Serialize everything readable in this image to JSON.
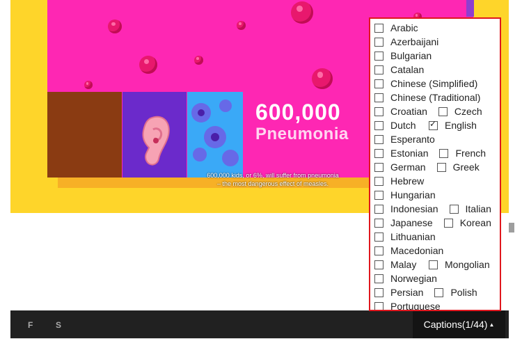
{
  "video": {
    "headline_number": "600,000",
    "headline_word": "Pneumonia",
    "subtitle_line1": "600,000 kids, or 6%, will suffer from pneumonia",
    "subtitle_line2": "– the most dangerous effect of measles."
  },
  "controls": {
    "left_buttons": [
      "F",
      "S"
    ],
    "captions_label": "Captions(1/44)",
    "captions_arrow": "▲"
  },
  "captions_menu": {
    "rows": [
      [
        {
          "label": "Arabic",
          "checked": false
        }
      ],
      [
        {
          "label": "Azerbaijani",
          "checked": false
        }
      ],
      [
        {
          "label": "Bulgarian",
          "checked": false
        }
      ],
      [
        {
          "label": "Catalan",
          "checked": false
        }
      ],
      [
        {
          "label": "Chinese (Simplified)",
          "checked": false
        }
      ],
      [
        {
          "label": "Chinese (Traditional)",
          "checked": false
        }
      ],
      [
        {
          "label": "Croatian",
          "checked": false
        },
        {
          "label": "Czech",
          "checked": false
        }
      ],
      [
        {
          "label": "Dutch",
          "checked": false
        },
        {
          "label": "English",
          "checked": true
        }
      ],
      [
        {
          "label": "Esperanto",
          "checked": false
        }
      ],
      [
        {
          "label": "Estonian",
          "checked": false
        },
        {
          "label": "French",
          "checked": false
        }
      ],
      [
        {
          "label": "German",
          "checked": false
        },
        {
          "label": "Greek",
          "checked": false
        }
      ],
      [
        {
          "label": "Hebrew",
          "checked": false
        }
      ],
      [
        {
          "label": "Hungarian",
          "checked": false
        }
      ],
      [
        {
          "label": "Indonesian",
          "checked": false
        },
        {
          "label": "Italian",
          "checked": false
        }
      ],
      [
        {
          "label": "Japanese",
          "checked": false
        },
        {
          "label": "Korean",
          "checked": false
        }
      ],
      [
        {
          "label": "Lithuanian",
          "checked": false
        }
      ],
      [
        {
          "label": "Macedonian",
          "checked": false
        }
      ],
      [
        {
          "label": "Malay",
          "checked": false
        },
        {
          "label": "Mongolian",
          "checked": false
        }
      ],
      [
        {
          "label": "Norwegian",
          "checked": false
        }
      ],
      [
        {
          "label": "Persian",
          "checked": false
        },
        {
          "label": "Polish",
          "checked": false
        }
      ],
      [
        {
          "label": "Portuguese",
          "checked": false
        }
      ]
    ]
  },
  "colors": {
    "highlight_border": "#e0171e",
    "video_background": "#fed52a",
    "magenta": "#fe27b3"
  }
}
